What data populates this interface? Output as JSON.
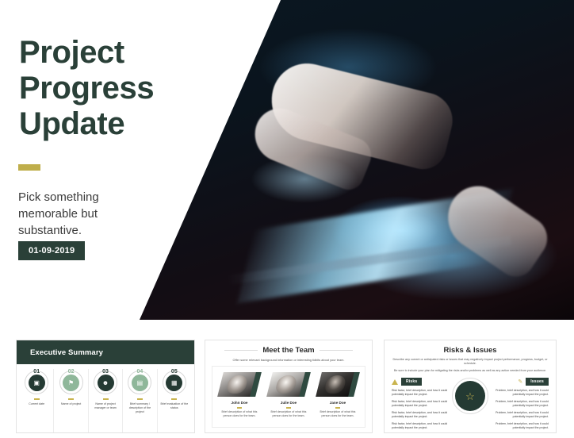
{
  "hero": {
    "title": "Project Progress Update",
    "subtitle": "Pick something memorable but substantive.",
    "date": "01-09-2019",
    "photo_alt": "finger touching glowing blue tablet screen in the dark"
  },
  "colors": {
    "brand_dark_green": "#2a4038",
    "brand_light_green": "#8fb79a",
    "gold_accent": "#bfae4b",
    "page_background": "#ffffff",
    "text_dark": "#2a2a2a"
  },
  "slides": {
    "executive_summary": {
      "title": "Executive Summary",
      "items": [
        {
          "number": "01",
          "icon": "calendar-icon",
          "glyph": "▣",
          "tone": "dark",
          "label": "Current date"
        },
        {
          "number": "02",
          "icon": "flag-icon",
          "glyph": "⚑",
          "tone": "light",
          "label": "Name of project"
        },
        {
          "number": "03",
          "icon": "person-icon",
          "glyph": "☻",
          "tone": "dark",
          "label": "Name of project manager or team"
        },
        {
          "number": "04",
          "icon": "document-icon",
          "glyph": "▤",
          "tone": "light",
          "label": "Brief summary / description of the project"
        },
        {
          "number": "05",
          "icon": "report-icon",
          "glyph": "▦",
          "tone": "dark",
          "label": "Brief evaluation of the status"
        }
      ]
    },
    "meet_the_team": {
      "title": "Meet the Team",
      "subtitle": "Offer some relevant background information or interesting tidbits about your team.",
      "members": [
        {
          "name": "John Doe",
          "description": "Brief description of what this person does for the team."
        },
        {
          "name": "Julie Doe",
          "description": "Brief description of what this person does for the team."
        },
        {
          "name": "Jane Doe",
          "description": "Brief description of what this person does for the team."
        }
      ]
    },
    "risks_and_issues": {
      "title": "Risks & Issues",
      "description_line1": "Describe any current or anticipated risks or issues that may negatively impact project performance, progress, budget, or schedule.",
      "description_line2": "Be sure to include your plan for mitigating the risks and/or problems as well as any action needed from your audience.",
      "risks": {
        "badge": "Risks",
        "icon": "warning-triangle-icon",
        "items": [
          "Risk factor, brief description, and how it could potentially impact the project.",
          "Risk factor, brief description, and how it could potentially impact the project.",
          "Risk factor, brief description, and how it could potentially impact the project.",
          "Risk factor, brief description, and how it could potentially impact the project."
        ]
      },
      "issues": {
        "badge": "Issues",
        "icon": "pencil-icon",
        "items": [
          "Problem, brief description, and how it could potentially impact the project.",
          "Problem, brief description, and how it could potentially impact the project.",
          "Problem, brief description, and how it could potentially impact the project.",
          "Problem, brief description, and how it could potentially impact the project."
        ]
      },
      "center_icon": "star-icon",
      "center_glyph": "☆"
    }
  }
}
